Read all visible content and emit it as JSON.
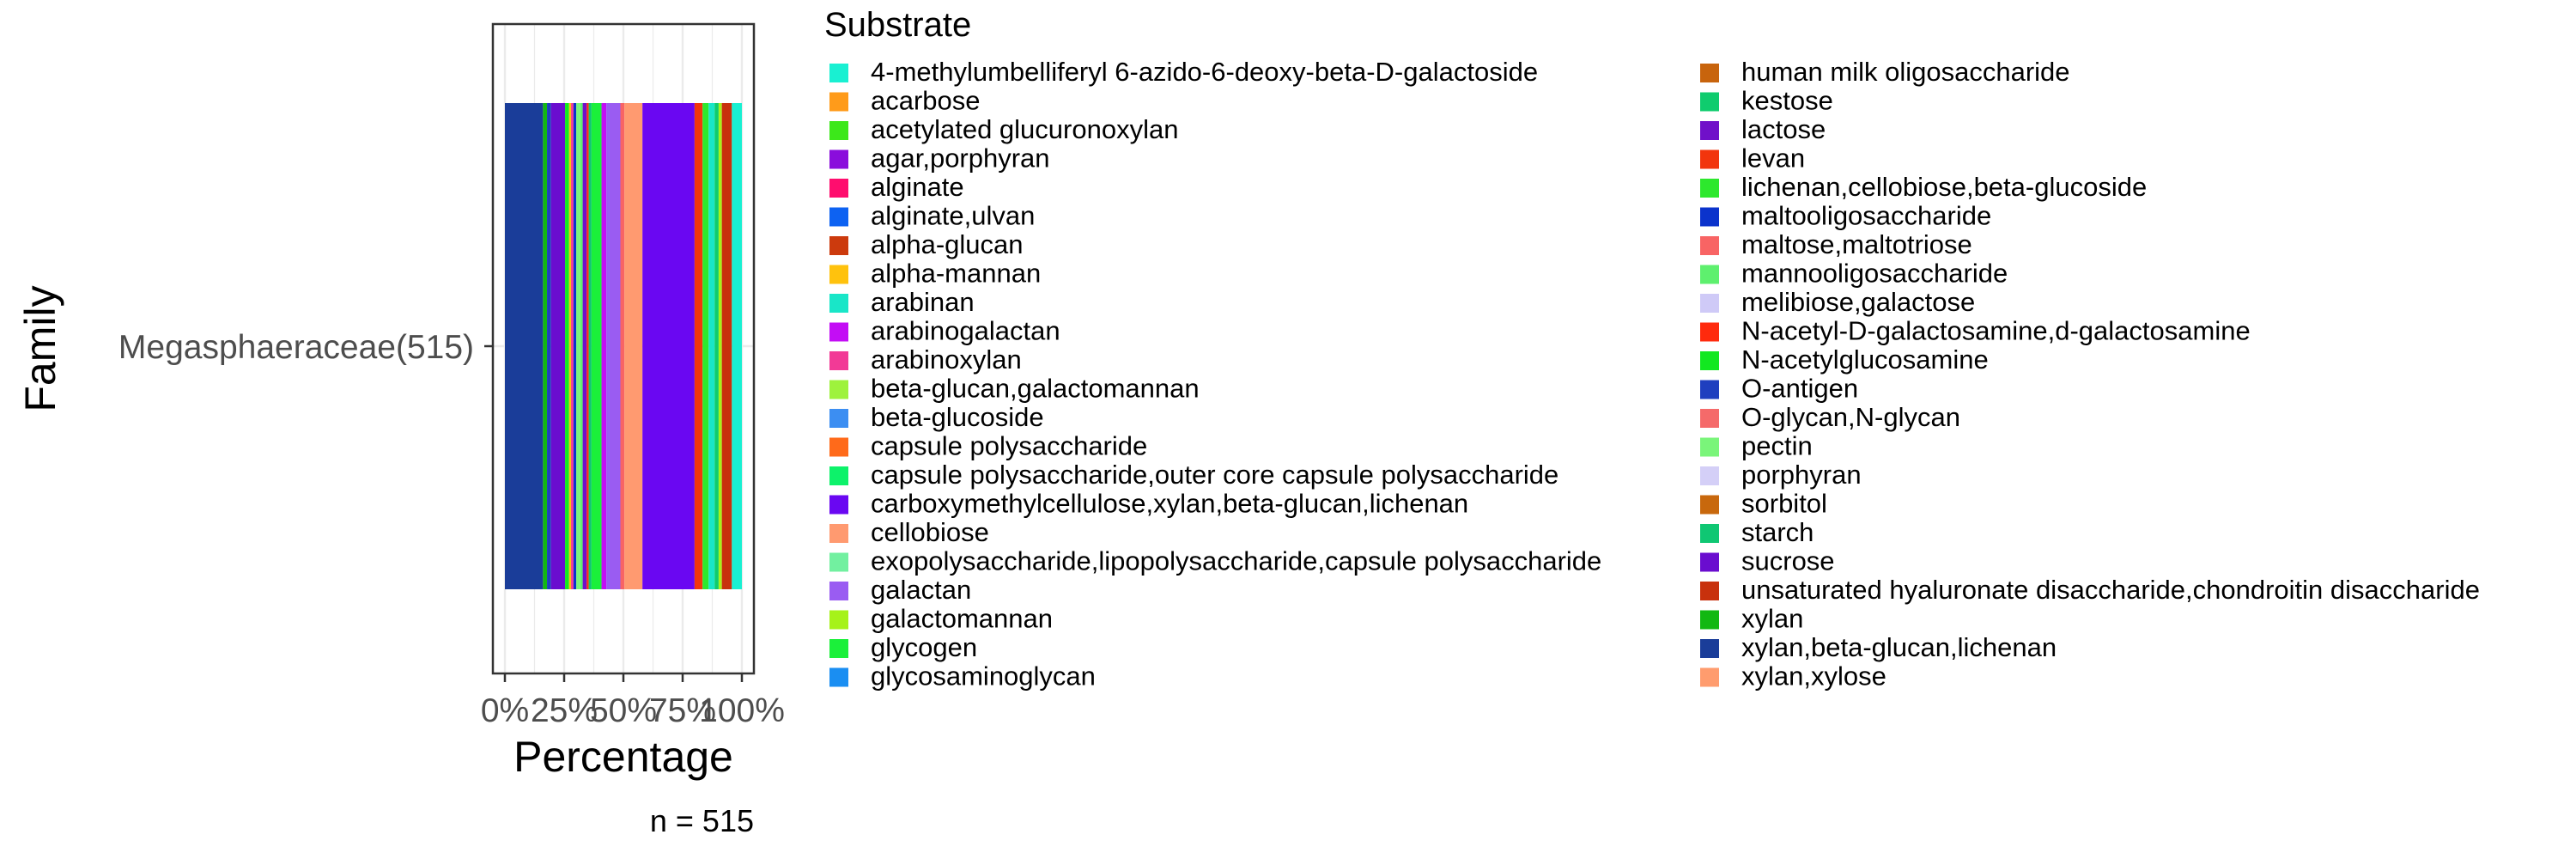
{
  "chart_data": {
    "type": "bar",
    "orientation": "horizontal",
    "stacked": true,
    "xlabel": "Percentage",
    "ylabel": "Family",
    "xlim": [
      0,
      100
    ],
    "x_ticks": [
      "0%",
      "25%",
      "50%",
      "75%",
      "100%"
    ],
    "x_tick_values": [
      0,
      25,
      50,
      75,
      100
    ],
    "categories": [
      "Megasphaeraceae(515)"
    ],
    "annotation": "n = 515",
    "grid": true,
    "legend_title": "Substrate",
    "legend_position": "right",
    "series": [
      {
        "name": "xylan,beta-glucan,lichenan",
        "color": "#1a3d99",
        "values": [
          9.5
        ]
      },
      {
        "name": "xylan",
        "color": "#12b812",
        "values": [
          1.0
        ]
      },
      {
        "name": "O-antigen",
        "color": "#1f3fbf",
        "values": [
          1.0
        ]
      },
      {
        "name": "sucrose",
        "color": "#6a0dcf",
        "values": [
          3.5
        ]
      },
      {
        "name": "N-acetylglucosamine",
        "color": "#12e820",
        "values": [
          1.0
        ]
      },
      {
        "name": "alpha-mannan",
        "color": "#ffc20d",
        "values": [
          0.5
        ]
      },
      {
        "name": "arabinoxylan",
        "color": "#f23a96",
        "values": [
          0.6
        ]
      },
      {
        "name": "maltooligosaccharide",
        "color": "#0b33cc",
        "values": [
          0.7
        ]
      },
      {
        "name": "pectin",
        "color": "#7af57a",
        "values": [
          1.0
        ]
      },
      {
        "name": "mannooligosaccharide",
        "color": "#5ef06e",
        "values": [
          0.6
        ]
      },
      {
        "name": "lactose",
        "color": "#7010c9",
        "values": [
          1.0
        ]
      },
      {
        "name": "N-acetyl-D-galactosamine,d-galactosamine",
        "color": "#ff2a0d",
        "values": [
          0.5
        ]
      },
      {
        "name": "starch",
        "color": "#0fc773",
        "values": [
          0.7
        ]
      },
      {
        "name": "glycogen",
        "color": "#1bf03a",
        "values": [
          2.5
        ]
      },
      {
        "name": "arabinogalactan",
        "color": "#c30df5",
        "values": [
          1.2
        ]
      },
      {
        "name": "galactan",
        "color": "#9a5cf2",
        "values": [
          3.5
        ]
      },
      {
        "name": "maltose,maltotriose",
        "color": "#f86464",
        "values": [
          1.0
        ]
      },
      {
        "name": "cellobiose",
        "color": "#ff9a70",
        "values": [
          4.5
        ]
      },
      {
        "name": "carboxymethylcellulose,xylan,beta-glucan,lichenan",
        "color": "#6a07f2",
        "values": [
          13.0
        ]
      },
      {
        "name": "levan",
        "color": "#f2350d",
        "values": [
          2.0
        ]
      },
      {
        "name": "lichenan,cellobiose,beta-glucoside",
        "color": "#2de82d",
        "values": [
          1.5
        ]
      },
      {
        "name": "arabinan",
        "color": "#19e6c8",
        "values": [
          1.5
        ]
      },
      {
        "name": "kestose",
        "color": "#0fcc6e",
        "values": [
          1.0
        ]
      },
      {
        "name": "galactomannan",
        "color": "#a6f21a",
        "values": [
          0.8
        ]
      },
      {
        "name": "unsaturated hyaluronate disaccharide,chondroitin disaccharide",
        "color": "#c8310d",
        "values": [
          2.5
        ]
      },
      {
        "name": "4-methylumbelliferyl 6-azido-6-deoxy-beta-D-galactoside",
        "color": "#19f0d2",
        "values": [
          2.5
        ]
      },
      {
        "name": "acarbose",
        "color": "#ff9b1a",
        "values": [
          0
        ]
      },
      {
        "name": "acetylated glucuronoxylan",
        "color": "#3ce81a",
        "values": [
          0
        ]
      },
      {
        "name": "agar,porphyran",
        "color": "#8a0ddc",
        "values": [
          0
        ]
      },
      {
        "name": "alginate",
        "color": "#ff0d6e",
        "values": [
          0
        ]
      },
      {
        "name": "alginate,ulvan",
        "color": "#0d62f2",
        "values": [
          0
        ]
      },
      {
        "name": "alpha-glucan",
        "color": "#cc3a0d",
        "values": [
          0
        ]
      },
      {
        "name": "beta-glucan,galactomannan",
        "color": "#9ef23c",
        "values": [
          0
        ]
      },
      {
        "name": "beta-glucoside",
        "color": "#3c8ef2",
        "values": [
          0
        ]
      },
      {
        "name": "capsule polysaccharide",
        "color": "#ff6a1a",
        "values": [
          0
        ]
      },
      {
        "name": "capsule polysaccharide,outer core capsule polysaccharide",
        "color": "#0df26a",
        "values": [
          0
        ]
      },
      {
        "name": "exopolysaccharide,lipopolysaccharide,capsule polysaccharide",
        "color": "#72f0a0",
        "values": [
          0
        ]
      },
      {
        "name": "glycosaminoglycan",
        "color": "#1a8ef2",
        "values": [
          0
        ]
      },
      {
        "name": "human milk oligosaccharide",
        "color": "#c8640d",
        "values": [
          0
        ]
      },
      {
        "name": "melibiose,galactose",
        "color": "#cfcaf7",
        "values": [
          0
        ]
      },
      {
        "name": "O-glycan,N-glycan",
        "color": "#f56a6a",
        "values": [
          0
        ]
      },
      {
        "name": "porphyran",
        "color": "#d4cff7",
        "values": [
          0
        ]
      },
      {
        "name": "sorbitol",
        "color": "#c8680d",
        "values": [
          0
        ]
      },
      {
        "name": "xylan,xylose",
        "color": "#ff9c6e",
        "values": [
          0
        ]
      }
    ]
  },
  "legend_order": [
    "4-methylumbelliferyl 6-azido-6-deoxy-beta-D-galactoside",
    "acarbose",
    "acetylated glucuronoxylan",
    "agar,porphyran",
    "alginate",
    "alginate,ulvan",
    "alpha-glucan",
    "alpha-mannan",
    "arabinan",
    "arabinogalactan",
    "arabinoxylan",
    "beta-glucan,galactomannan",
    "beta-glucoside",
    "capsule polysaccharide",
    "capsule polysaccharide,outer core capsule polysaccharide",
    "carboxymethylcellulose,xylan,beta-glucan,lichenan",
    "cellobiose",
    "exopolysaccharide,lipopolysaccharide,capsule polysaccharide",
    "galactan",
    "galactomannan",
    "glycogen",
    "glycosaminoglycan",
    "human milk oligosaccharide",
    "kestose",
    "lactose",
    "levan",
    "lichenan,cellobiose,beta-glucoside",
    "maltooligosaccharide",
    "maltose,maltotriose",
    "mannooligosaccharide",
    "melibiose,galactose",
    "N-acetyl-D-galactosamine,d-galactosamine",
    "N-acetylglucosamine",
    "O-antigen",
    "O-glycan,N-glycan",
    "pectin",
    "porphyran",
    "sorbitol",
    "starch",
    "sucrose",
    "unsaturated hyaluronate disaccharide,chondroitin disaccharide",
    "xylan",
    "xylan,beta-glucan,lichenan",
    "xylan,xylose"
  ]
}
